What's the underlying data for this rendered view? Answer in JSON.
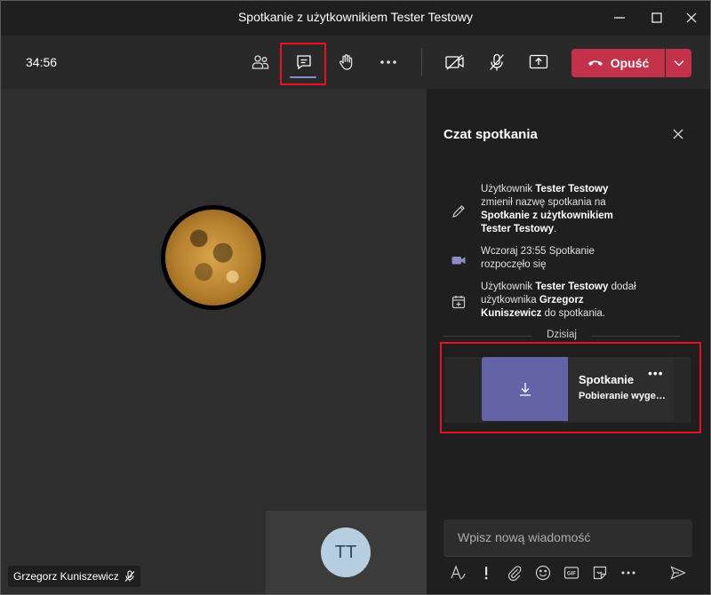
{
  "window": {
    "title": "Spotkanie z użytkownikiem Tester Testowy"
  },
  "toolbar": {
    "timer": "34:56",
    "leave_label": "Opuść"
  },
  "stage": {
    "participant_name": "Grzegorz Kuniszewicz",
    "self_initials": "TT"
  },
  "chat": {
    "title": "Czat spotkania",
    "messages": [
      {
        "icon": "pencil-icon",
        "parts": [
          "Użytkownik ",
          "Tester Testowy",
          " zmienił nazwę spotkania na ",
          "Spotkanie z użytkownikiem Tester Testowy",
          "."
        ]
      },
      {
        "icon": "meeting-camera-icon",
        "parts": [
          "Wczoraj 23:55   Spotkanie rozpoczęło się"
        ]
      },
      {
        "icon": "calendar-add-icon",
        "parts": [
          "Użytkownik ",
          "Tester Testowy",
          " dodał użytkownika ",
          "Grzegorz Kuniszewicz",
          " do spotkania."
        ]
      }
    ],
    "day_separator": "Dzisiaj",
    "card": {
      "name": "Spotkanie",
      "status": "Pobieranie wygenerowanego pliku",
      "more": "•••"
    },
    "compose_placeholder": "Wpisz nową wiadomość"
  },
  "colors": {
    "accent": "#6264a7",
    "leave": "#c4314b",
    "highlight": "#e81123"
  }
}
